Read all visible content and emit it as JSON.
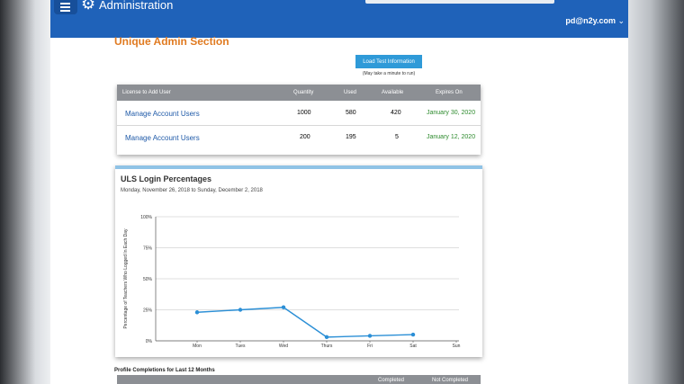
{
  "header": {
    "title": "Administration",
    "user": "pd@n2y.com",
    "colors": {
      "bar": "#1f62b9"
    }
  },
  "section_title": "Unique Admin Section",
  "load_button": {
    "label": "Load Test Information",
    "note": "(May take a minute to run)"
  },
  "license_table": {
    "columns": [
      "License to Add User",
      "Quantity",
      "Used",
      "Available",
      "Expires On"
    ],
    "rows": [
      {
        "name": "Manage Account Users",
        "quantity": "1000",
        "used": "580",
        "available": "420",
        "expires": "January 30, 2020"
      },
      {
        "name": "Manage Account Users",
        "quantity": "200",
        "used": "195",
        "available": "5",
        "expires": "January 12, 2020"
      }
    ]
  },
  "login_chart": {
    "title": "ULS Login Percentages",
    "subtitle": "Monday, November 26, 2018 to Sunday, December 2, 2018"
  },
  "chart_data": {
    "type": "line",
    "title": "ULS Login Percentages",
    "subtitle": "Monday, November 26, 2018 to Sunday, December 2, 2018",
    "xlabel": "",
    "ylabel": "Percentage of Teachers Who Logged In Each Day",
    "categories": [
      "Mon",
      "Tues",
      "Wed",
      "Thurs",
      "Fri",
      "Sat",
      "Sun"
    ],
    "values": [
      23,
      25,
      27,
      3,
      4,
      5,
      null
    ],
    "yticks": [
      "0%",
      "25%",
      "50%",
      "75%",
      "100%"
    ],
    "ylim": [
      0,
      100
    ],
    "grid": true,
    "color": "#2b8fd6"
  },
  "profile": {
    "title": "Profile Completions for Last 12 Months",
    "columns": [
      "Completed",
      "Not Completed"
    ]
  }
}
